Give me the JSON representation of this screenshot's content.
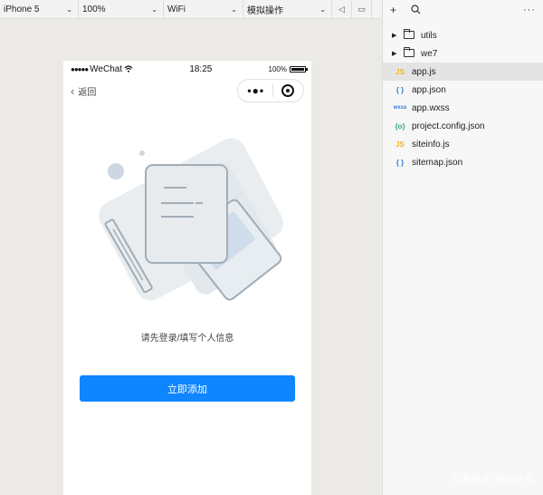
{
  "toolbar": {
    "device": "iPhone 5",
    "zoom": "100%",
    "network": "WiFi",
    "operation": "模拟操作"
  },
  "phone": {
    "status": {
      "carrier": "WeChat",
      "time": "18:25",
      "battery": "100%"
    },
    "nav": {
      "back_label": "返回"
    },
    "empty_text": "请先登录/填写个人信息",
    "add_button": "立即添加"
  },
  "explorer": {
    "files": [
      {
        "name": "utils",
        "type": "folder",
        "icon": "folder-icon"
      },
      {
        "name": "we7",
        "type": "folder",
        "icon": "folder-icon"
      },
      {
        "name": "app.js",
        "type": "js",
        "badge": "JS",
        "color": "#f0b429",
        "selected": true
      },
      {
        "name": "app.json",
        "type": "json",
        "badge": "{ }",
        "color": "#2f7bd9"
      },
      {
        "name": "app.wxss",
        "type": "wxss",
        "badge": "wxss",
        "color": "#2f7bd9"
      },
      {
        "name": "project.config.json",
        "type": "config",
        "badge": "{o}",
        "color": "#2aa87a"
      },
      {
        "name": "siteinfo.js",
        "type": "js",
        "badge": "JS",
        "color": "#f0b429"
      },
      {
        "name": "sitemap.json",
        "type": "json",
        "badge": "{ }",
        "color": "#2f7bd9"
      }
    ]
  },
  "watermark": "百家号/好源码分享",
  "colors": {
    "accent": "#0f86ff",
    "canvas": "#ebeae7"
  }
}
